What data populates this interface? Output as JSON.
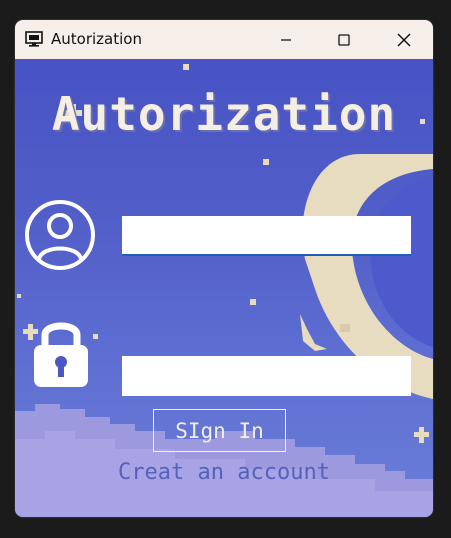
{
  "window": {
    "title": "Autorization",
    "controls": [
      "minimize-icon",
      "maximize-icon",
      "close-icon"
    ]
  },
  "form": {
    "heading": "Autorization",
    "login_field": {
      "value": "",
      "placeholder": ""
    },
    "password_field": {
      "value": "",
      "placeholder": ""
    },
    "signin_label": "SIgn In",
    "create_account_label": "Creat an account"
  },
  "icons": {
    "app": "monitor-icon",
    "login": "user-icon",
    "password": "lock-icon"
  },
  "colors": {
    "background_top": "#4853c4",
    "background_bottom": "#6b7ed7",
    "text_light": "#f4eee4",
    "moon": "#e8dcc0",
    "clouds": "#a59fe2",
    "link": "#5561ba"
  }
}
